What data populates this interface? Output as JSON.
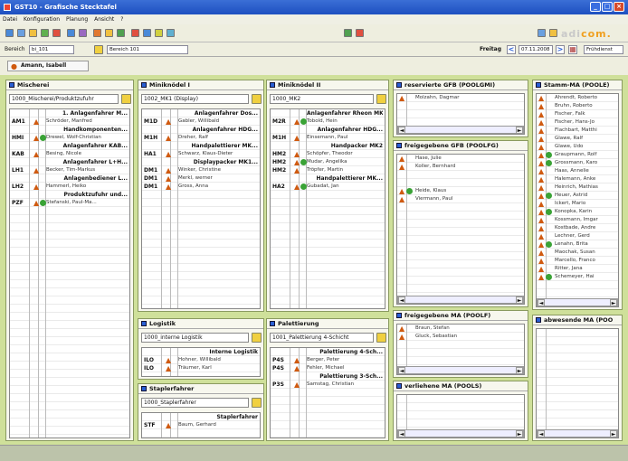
{
  "window": {
    "title": "GST10 - Grafische Stecktafel"
  },
  "menu": [
    "Datei",
    "Konfiguration",
    "Planung",
    "Ansicht",
    "?"
  ],
  "logo": {
    "pre": "adi",
    "post": "com."
  },
  "bereich": {
    "label": "Bereich",
    "code": "bi_101",
    "value": "Bereich 101"
  },
  "date": {
    "day": "Freitag",
    "value": "07.11.2008",
    "shift": "Frühdienst"
  },
  "user": "Amann, Isabell",
  "panels": {
    "mischerei": {
      "title": "Mischerei",
      "select": "1000_Mischerei/Produktzufuhr",
      "rows": [
        {
          "h": "1. Anlagenfahrer M..."
        },
        {
          "c": "AM1",
          "p": true,
          "n": "Schröder, Manfred"
        },
        {
          "h": "Handkomponenten..."
        },
        {
          "c": "HMI",
          "p": true,
          "k": true,
          "n": "Drewel, Wolf-Christian"
        },
        {
          "h": "Anlagenfahrer KAB..."
        },
        {
          "c": "KAB",
          "p": true,
          "n": "Besing, Nicole"
        },
        {
          "h": "Anlagenfahrer L+H..."
        },
        {
          "c": "LH1",
          "p": true,
          "n": "Becker, Tim-Markus"
        },
        {
          "h": "Anlagenbediener L..."
        },
        {
          "c": "LH2",
          "p": true,
          "n": "Hammerl, Heiko"
        },
        {
          "h": "Produktzufuhr und..."
        },
        {
          "c": "PZF",
          "p": true,
          "k": true,
          "n": "Stefanski, Paul-Ma..."
        }
      ]
    },
    "mini1": {
      "title": "Miniknödel I",
      "select": "1002_MK1 (Display)",
      "rows": [
        {
          "h": "Anlagenfahrer Dos..."
        },
        {
          "c": "M1D",
          "p": true,
          "n": "Gabler, Willibald"
        },
        {
          "h": "Anlagenfahrer HDG..."
        },
        {
          "c": "M1H",
          "p": true,
          "n": "Dreher, Ralf"
        },
        {
          "h": "Handpalettierer MK..."
        },
        {
          "c": "HA1",
          "p": true,
          "n": "Schwarz, Klaus-Dieter"
        },
        {
          "h": "Displaypacker MK1..."
        },
        {
          "c": "DM1",
          "p": true,
          "n": "Winker, Christine"
        },
        {
          "c": "DM1",
          "p": true,
          "n": "Merkl, werner"
        },
        {
          "c": "DM1",
          "p": true,
          "n": "Gross, Anna"
        }
      ]
    },
    "mini2": {
      "title": "Miniknödel II",
      "select": "1000_MK2",
      "rows": [
        {
          "h": "Anlagenfahrer Rheon MK"
        },
        {
          "c": "M2R",
          "p": true,
          "k": true,
          "n": "Tobold, Hein"
        },
        {
          "h": "Anlagenfahrer HDG..."
        },
        {
          "c": "M1H",
          "p": true,
          "n": "Einsemann, Paul"
        },
        {
          "h": "Handpacker MK2"
        },
        {
          "c": "HM2",
          "p": true,
          "n": "Schöpfer, Theodor"
        },
        {
          "c": "HM2",
          "p": true,
          "k": true,
          "n": "Mudar, Angelika"
        },
        {
          "c": "HM2",
          "p": true,
          "n": "Tröpfer, Martin"
        },
        {
          "h": "Handpalettierer MK..."
        },
        {
          "c": "HA2",
          "p": true,
          "k": true,
          "n": "Gubadat, Jan"
        }
      ]
    },
    "logistik": {
      "title": "Logistik",
      "select": "1000_interne Logistik",
      "rows": [
        {
          "h": "Interne Logistik"
        },
        {
          "c": "ILO",
          "p": true,
          "n": "Hohner, Willibald"
        },
        {
          "c": "ILO",
          "p": true,
          "n": "Träumer, Karl"
        }
      ]
    },
    "stapler": {
      "title": "Staplerfahrer",
      "select": "1000_Staplerfahrer",
      "rows": [
        {
          "h": "Staplerfahrer"
        },
        {
          "c": "STF",
          "p": true,
          "n": "Baum, Gerhard"
        }
      ]
    },
    "palett": {
      "title": "Palettierung",
      "select": "1001_Palettierung 4-Schicht",
      "rows": [
        {
          "h": "Palettierung 4-Sch..."
        },
        {
          "c": "P4S",
          "p": true,
          "n": "Berger, Peter"
        },
        {
          "c": "P4S",
          "p": true,
          "n": "Fehler, Michael"
        },
        {
          "h": "Palettierung 3-Sch..."
        },
        {
          "c": "P3S",
          "p": true,
          "n": "Samstag, Christian"
        }
      ]
    },
    "resgfb": {
      "title": "reservierte GFB (POOLGMI)",
      "items": [
        {
          "n": "Molzahn, Dagmar"
        }
      ]
    },
    "freigfb": {
      "title": "freigegebene GFB (POOLFG)",
      "items": [
        {
          "n": "Hase, Julie"
        },
        {
          "n": "Koller, Bernhard"
        },
        {
          "n": ""
        },
        {
          "n": ""
        },
        {
          "k": true,
          "n": "Heide, Klaus"
        },
        {
          "n": "Viermann, Paul"
        }
      ]
    },
    "freima": {
      "title": "freigegebene MA (POOLF)",
      "items": [
        {
          "n": "Braun, Stefan"
        },
        {
          "n": "Gluck, Sebastian"
        }
      ]
    },
    "verlma": {
      "title": "verliehene MA (POOLS)",
      "items": []
    },
    "stamm": {
      "title": "Stamm-MA (POOLE)",
      "items": [
        {
          "n": "Ahrendt, Roberto"
        },
        {
          "n": "Bruhn, Roberto"
        },
        {
          "n": "Fischer, Falk"
        },
        {
          "n": "Fischer, Hans-Jo"
        },
        {
          "n": "Flachbart, Matthi"
        },
        {
          "n": "Glawe, Ralf"
        },
        {
          "n": "Glawe, Udo"
        },
        {
          "k": true,
          "n": "Graupmann, Rolf"
        },
        {
          "k": true,
          "n": "Grossmann, Karo"
        },
        {
          "n": "Haas, Annelie"
        },
        {
          "n": "Halemann, Anke"
        },
        {
          "n": "Heinrich, Mathias"
        },
        {
          "k": true,
          "n": "Heuer, Astrid"
        },
        {
          "n": "Ickert, Mario"
        },
        {
          "k": true,
          "n": "Konopka, Karin"
        },
        {
          "n": "Kossmann, Imgar"
        },
        {
          "n": "Kostbade, Andre"
        },
        {
          "n": "Lechner, Gerd"
        },
        {
          "k": true,
          "n": "Lenahn, Brita"
        },
        {
          "n": "Maochak, Susan"
        },
        {
          "n": "Marcello, Franco"
        },
        {
          "n": "Ritter, Jana"
        },
        {
          "k": true,
          "n": "Schemeyer, Hai"
        }
      ]
    },
    "abw": {
      "title": "abwesende MA (POO",
      "items": []
    }
  }
}
